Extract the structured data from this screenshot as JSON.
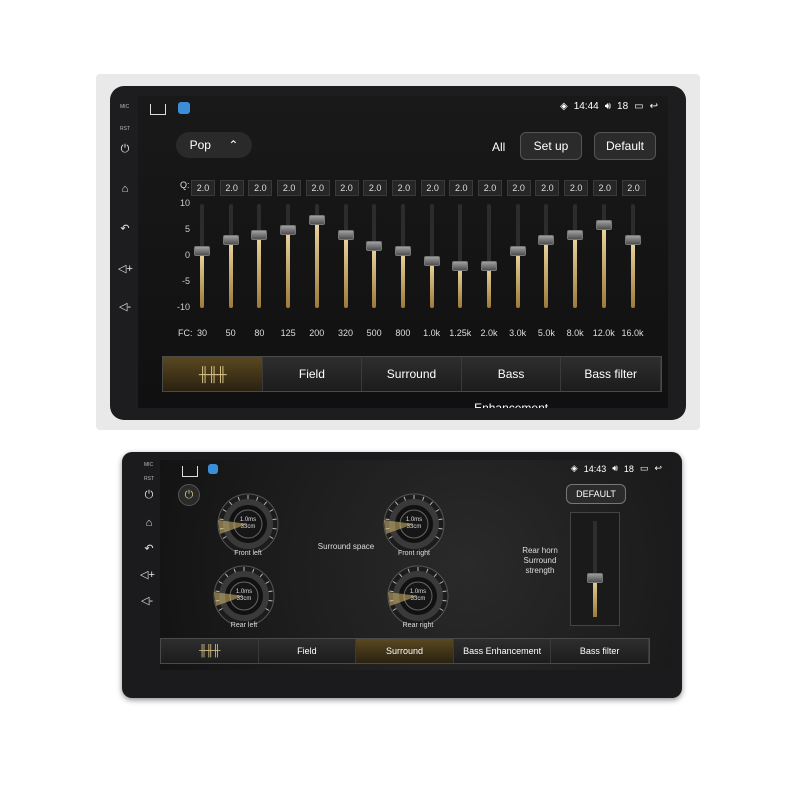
{
  "top_unit": {
    "side_labels": {
      "mic": "MIC",
      "rst": "RST"
    },
    "side_icons": [
      "power-icon",
      "home-icon",
      "back-icon",
      "volume-up-icon",
      "volume-down-icon"
    ],
    "status": {
      "time": "14:44",
      "volume": "18"
    },
    "preset": "Pop",
    "all_label": "All",
    "setup_label": "Set up",
    "default_label": "Default",
    "q_label": "Q:",
    "fc_label": "FC:",
    "scale": [
      "10",
      "5",
      "0",
      "-5",
      "-10"
    ],
    "bands": [
      {
        "q": "2.0",
        "fc": "30",
        "level": 1
      },
      {
        "q": "2.0",
        "fc": "50",
        "level": 3
      },
      {
        "q": "2.0",
        "fc": "80",
        "level": 4
      },
      {
        "q": "2.0",
        "fc": "125",
        "level": 5
      },
      {
        "q": "2.0",
        "fc": "200",
        "level": 7
      },
      {
        "q": "2.0",
        "fc": "320",
        "level": 4
      },
      {
        "q": "2.0",
        "fc": "500",
        "level": 2
      },
      {
        "q": "2.0",
        "fc": "800",
        "level": 1
      },
      {
        "q": "2.0",
        "fc": "1.0k",
        "level": -1
      },
      {
        "q": "2.0",
        "fc": "1.25k",
        "level": -2
      },
      {
        "q": "2.0",
        "fc": "2.0k",
        "level": -2
      },
      {
        "q": "2.0",
        "fc": "3.0k",
        "level": 1
      },
      {
        "q": "2.0",
        "fc": "5.0k",
        "level": 3
      },
      {
        "q": "2.0",
        "fc": "8.0k",
        "level": 4
      },
      {
        "q": "2.0",
        "fc": "12.0k",
        "level": 6
      },
      {
        "q": "2.0",
        "fc": "16.0k",
        "level": 3
      }
    ],
    "tabs": [
      "",
      "Field",
      "Surround",
      "Bass Enhancement",
      "Bass filter"
    ],
    "active_tab": 0
  },
  "bottom_unit": {
    "side_labels": {
      "mic": "MIC",
      "rst": "RST"
    },
    "status": {
      "time": "14:43",
      "volume": "18"
    },
    "default_label": "DEFAULT",
    "gauges": [
      {
        "label": "Front left",
        "readout": "1.0ms\n33cm"
      },
      {
        "label": "Front right",
        "readout": "1.0ms\n33cm"
      },
      {
        "label": "Rear left",
        "readout": "1.0ms\n33cm"
      },
      {
        "label": "Rear right",
        "readout": "1.0ms\n33cm"
      }
    ],
    "surround_space": "Surround space",
    "rear_horn": "Rear horn Surround strength",
    "tabs": [
      "",
      "Field",
      "Surround",
      "Bass Enhancement",
      "Bass filter"
    ],
    "active_tab": 2
  }
}
